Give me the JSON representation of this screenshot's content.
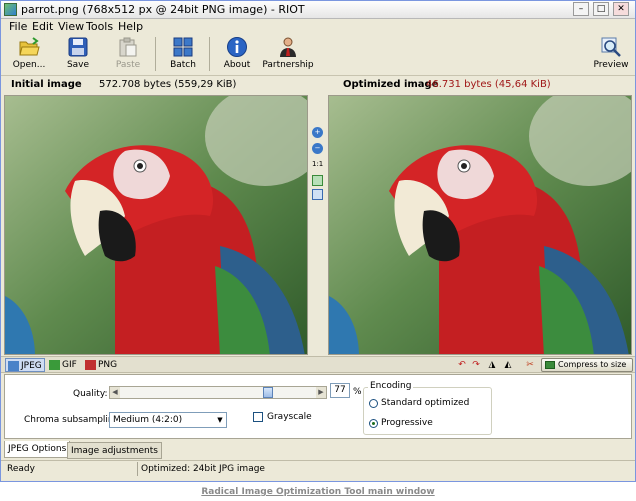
{
  "window": {
    "title": "parrot.png (768x512 px @ 24bit PNG image) - RIOT",
    "controls": [
      "–",
      "□",
      "✕"
    ]
  },
  "menu": [
    "File",
    "Edit",
    "View",
    "Tools",
    "Help"
  ],
  "toolbar": {
    "open": "Open...",
    "save": "Save",
    "paste": "Paste",
    "batch": "Batch",
    "about": "About",
    "partnership": "Partnership",
    "preview": "Preview"
  },
  "initial": {
    "label": "Initial image",
    "size": "572.708 bytes (559,29 KiB)"
  },
  "optimized": {
    "label": "Optimized image",
    "size": "46.731 bytes (45,64 KiB)"
  },
  "midtools": {
    "ratio": "1:1"
  },
  "formats": [
    "JPEG",
    "GIF",
    "PNG"
  ],
  "compress_button": "Compress to size",
  "options": {
    "quality_label": "Quality:",
    "quality_value": "77",
    "quality_unit": "%",
    "quality_fraction": 0.77,
    "chroma_label": "Chroma subsampling:",
    "chroma_value": "Medium (4:2:0)",
    "grayscale_label": "Grayscale",
    "encoding_title": "Encoding",
    "encoding_options": [
      "Standard optimized",
      "Progressive"
    ],
    "encoding_selected": 1
  },
  "bottom_tabs": [
    "JPEG Options",
    "Image adjustments"
  ],
  "status": {
    "left": "Ready",
    "right": "Optimized: 24bit JPG image"
  },
  "caption": "Radical Image Optimization Tool main window",
  "colors": {
    "optimized_size": "#a01818",
    "window_bg": "#ece9d8",
    "accent": "#316ac5"
  }
}
